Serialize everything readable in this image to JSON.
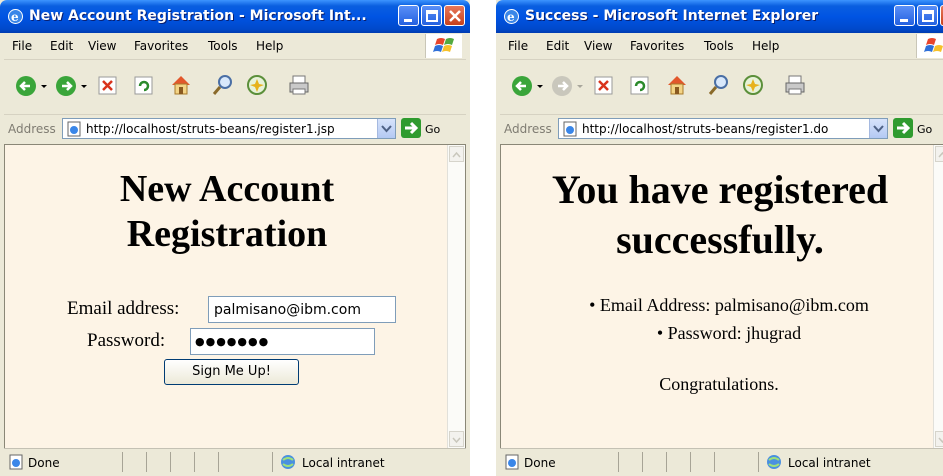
{
  "window1": {
    "title": "New Account Registration - Microsoft Int...",
    "menu": [
      "File",
      "Edit",
      "View",
      "Favorites",
      "Tools",
      "Help"
    ],
    "address_label": "Address",
    "url": "http://localhost/struts-beans/register1.jsp",
    "go_label": "Go",
    "heading_line1": "New Account",
    "heading_line2": "Registration",
    "email_label": "Email address:",
    "email_value": "palmisano@ibm.com",
    "password_label": "Password:",
    "password_value": "●●●●●●●",
    "submit_label": "Sign Me Up!",
    "status": "Done",
    "zone": "Local intranet"
  },
  "window2": {
    "title": "Success - Microsoft Internet Explorer",
    "menu": [
      "File",
      "Edit",
      "View",
      "Favorites",
      "Tools",
      "Help"
    ],
    "address_label": "Address",
    "url": "http://localhost/struts-beans/register1.do",
    "go_label": "Go",
    "heading_line1": "You have registered",
    "heading_line2": "successfully.",
    "bullets": [
      "Email Address: palmisano@ibm.com",
      "Password: jhugrad"
    ],
    "congrats": "Congratulations.",
    "status": "Done",
    "zone": "Local intranet"
  },
  "colors": {
    "titlebar": "#0054e3",
    "page_background": "#fdf4e6",
    "chrome": "#ece9d8"
  }
}
